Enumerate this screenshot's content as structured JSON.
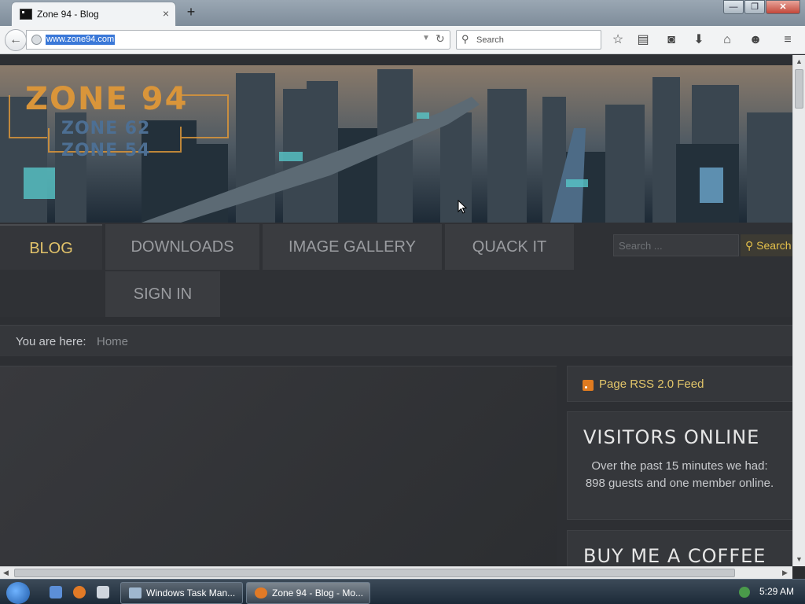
{
  "browser": {
    "tab_title": "Zone 94 - Blog",
    "tab_close": "×",
    "new_tab": "+",
    "url": "www.zone94.com",
    "search_placeholder": "Search",
    "back": "←",
    "reload": "↻"
  },
  "header": {
    "logo_main": "ZONE 94",
    "logo_line2": "ZONE 62",
    "logo_line3": "ZONE 54"
  },
  "menu": {
    "items": [
      {
        "label": "BLOG",
        "active": true
      },
      {
        "label": "DOWNLOADS"
      },
      {
        "label": "IMAGE GALLERY"
      },
      {
        "label": "QUACK IT"
      },
      {
        "label": "SIGN IN"
      }
    ],
    "search_placeholder": "Search ...",
    "search_button": "Search"
  },
  "breadcrumb": {
    "label": "You are here:",
    "home": "Home"
  },
  "sidebar": {
    "rss_text": "Page RSS 2.0 Feed",
    "visitors_title": "VISITORS ONLINE",
    "visitors_text": "Over the past 15 minutes we had: 898 guests and one member online.",
    "coffee_title": "BUY ME A COFFEE"
  },
  "taskbar": {
    "task1": "Windows Task Man...",
    "task2": "Zone 94 - Blog - Mo...",
    "clock": "5:29 AM"
  },
  "colors": {
    "accent": "#e1c26a",
    "logo_orange": "#d9953a",
    "logo_blue": "#4d6f93"
  }
}
